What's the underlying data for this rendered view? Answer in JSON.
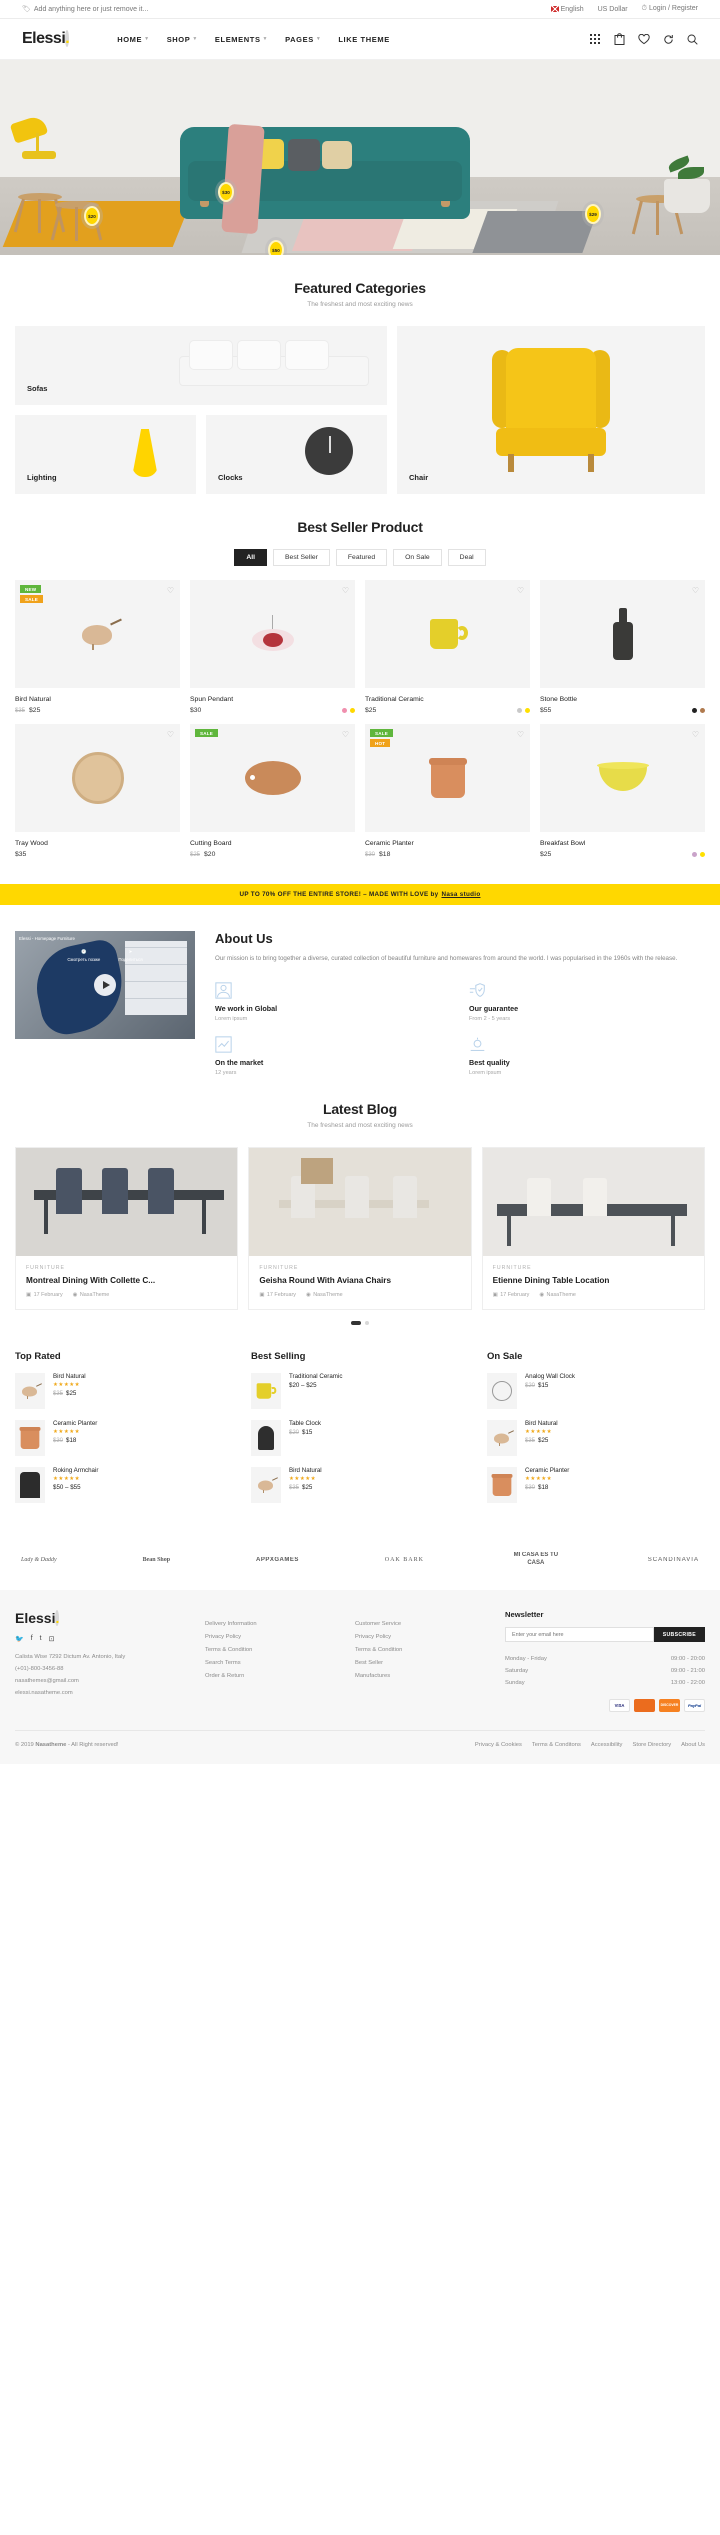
{
  "topbar": {
    "notice": "Add anything here or just remove it...",
    "language": "English",
    "currency": "US Dollar",
    "account": "Login / Register"
  },
  "header": {
    "logo": "Elessi",
    "logo_dot": ".",
    "nav": [
      "HOME",
      "SHOP",
      "ELEMENTS",
      "PAGES",
      "LIKE THEME"
    ],
    "icons": [
      "grid-icon",
      "bag-icon",
      "heart-icon",
      "refresh-icon",
      "search-icon"
    ]
  },
  "hero": {
    "price_tags": [
      "$20",
      "$30",
      "$50",
      "$29"
    ]
  },
  "featured_categories": {
    "title": "Featured Categories",
    "subtitle": "The freshest and most exciting news",
    "items": [
      {
        "label": "Sofas"
      },
      {
        "label": "Lighting"
      },
      {
        "label": "Clocks"
      },
      {
        "label": "Chair"
      }
    ]
  },
  "best_seller": {
    "title": "Best Seller Product",
    "tabs": [
      "All",
      "Best Seller",
      "Featured",
      "On Sale",
      "Deal"
    ],
    "active_tab": "All",
    "products": [
      {
        "name": "Bird Natural",
        "price": "$25",
        "old_price": "$35",
        "badges": [
          "NEW",
          "SALE"
        ],
        "swatches": []
      },
      {
        "name": "Spun Pendant",
        "price": "$30",
        "old_price": "",
        "badges": [],
        "swatches": [
          "#f08fae",
          "#ffd800"
        ]
      },
      {
        "name": "Traditional Ceramic",
        "price": "$25",
        "old_price": "",
        "badges": [],
        "swatches": [
          "#c9c9c9",
          "#ffe000"
        ]
      },
      {
        "name": "Stone Bottle",
        "price": "$55",
        "old_price": "",
        "badges": [],
        "swatches": [
          "#222222",
          "#b07a4e"
        ]
      },
      {
        "name": "Tray Wood",
        "price": "$35",
        "old_price": "",
        "badges": [],
        "swatches": []
      },
      {
        "name": "Cutting Board",
        "price": "$20",
        "old_price": "$25",
        "badges": [
          "SALE"
        ],
        "swatches": []
      },
      {
        "name": "Ceramic Planter",
        "price": "$18",
        "old_price": "$30",
        "badges": [
          "SALE",
          "HOT"
        ],
        "swatches": []
      },
      {
        "name": "Breakfast Bowl",
        "price": "$25",
        "old_price": "",
        "badges": [],
        "swatches": [
          "#c9a3c9",
          "#ffe000"
        ]
      }
    ]
  },
  "promo": {
    "text": "UP TO 70% OFF THE ENTIRE STORE! – MADE WITH LOVE by",
    "link": "Nasa studio"
  },
  "about": {
    "video": {
      "title": "Elessi - Homepage Furniture",
      "overlay_later": "Смотреть позже",
      "overlay_share": "Поделиться"
    },
    "title": "About Us",
    "paragraph": "Our mission is to bring together a diverse, curated collection of beautiful furniture and homewares from around the world. I was popularised in the 1960s with the release.",
    "features": [
      {
        "icon": "globe-person-icon",
        "title": "We work in Global",
        "sub": "Lorem ipsum"
      },
      {
        "icon": "shield-check-icon",
        "title": "Our guarantee",
        "sub": "From 2 - 5 years"
      },
      {
        "icon": "market-chart-icon",
        "title": "On the market",
        "sub": "12 years"
      },
      {
        "icon": "quality-badge-icon",
        "title": "Best quality",
        "sub": "Lorem ipsum"
      }
    ]
  },
  "blog": {
    "title": "Latest Blog",
    "subtitle": "The freshest and most exciting news",
    "posts": [
      {
        "category": "FURNITURE",
        "title": "Montreal Dining With Collette C...",
        "date": "17 February",
        "author": "NasaTheme"
      },
      {
        "category": "FURNITURE",
        "title": "Geisha Round With Aviana Chairs",
        "date": "17 February",
        "author": "NasaTheme"
      },
      {
        "category": "FURNITURE",
        "title": "Etienne Dining Table Location",
        "date": "17 February",
        "author": "NasaTheme"
      }
    ]
  },
  "lists": [
    {
      "title": "Top Rated",
      "items": [
        {
          "name": "Bird Natural",
          "stars": "★★★★★",
          "price": "$25",
          "old_price": "$35",
          "art": "bird"
        },
        {
          "name": "Ceramic Planter",
          "stars": "★★★★★",
          "price": "$18",
          "old_price": "$30",
          "art": "planter"
        },
        {
          "name": "Roking Armchair",
          "stars": "★★★★★",
          "price": "$50 – $55",
          "old_price": "",
          "art": "armchair"
        }
      ]
    },
    {
      "title": "Best Selling",
      "items": [
        {
          "name": "Traditional Ceramic",
          "stars": "",
          "price": "$20 – $25",
          "old_price": "",
          "art": "mug"
        },
        {
          "name": "Table Clock",
          "stars": "",
          "price": "$15",
          "old_price": "$20",
          "art": "clock"
        },
        {
          "name": "Bird Natural",
          "stars": "★★★★★",
          "price": "$25",
          "old_price": "$35",
          "art": "bird"
        }
      ]
    },
    {
      "title": "On Sale",
      "items": [
        {
          "name": "Analog Wall Clock",
          "stars": "",
          "price": "$15",
          "old_price": "$20",
          "art": "wallclock"
        },
        {
          "name": "Bird Natural",
          "stars": "★★★★★",
          "price": "$25",
          "old_price": "$35",
          "art": "bird"
        },
        {
          "name": "Ceramic Planter",
          "stars": "★★★★★",
          "price": "$18",
          "old_price": "$30",
          "art": "planter"
        }
      ]
    }
  ],
  "brands": [
    "Lady & Daddy",
    "Bean Shop",
    "APPXGAMES",
    "OAK BARK",
    "MI CASA ES TU CASA",
    "SCANDINAVIA"
  ],
  "footer": {
    "logo": "Elessi",
    "logo_dot": ".",
    "social": [
      "twitter-icon",
      "facebook-icon",
      "tumblr-icon",
      "instagram-icon"
    ],
    "address": "Calista Wise 7292 Dictum Av. Antonio, Italy",
    "phone": "(+01)-800-3456-88",
    "email": "nasathemes@gmail.com",
    "site": "elessi.nasatheme.com",
    "col2_title": "",
    "col2": [
      "Delivery Information",
      "Privacy Policy",
      "Terms & Condition",
      "Search Terms",
      "Order & Return"
    ],
    "col3_title": "",
    "col3": [
      "Customer Service",
      "Privacy Policy",
      "Terms & Condition",
      "Best Seller",
      "Manufactures"
    ],
    "newsletter": {
      "title": "Newsletter",
      "placeholder": "Enter your email here",
      "button": "SUBSCRIBE"
    },
    "hours": [
      {
        "day": "Monday - Friday",
        "time": "09:00 - 20:00"
      },
      {
        "day": "Saturday",
        "time": "09:00 - 21:00"
      },
      {
        "day": "Sunday",
        "time": "13:00 - 22:00"
      }
    ],
    "payments": [
      "VISA",
      "MC",
      "DISCOVER",
      "PayPal"
    ],
    "copyright_pre": "© 2019 ",
    "copyright_brand": "Nasatheme",
    "copyright_post": " - All Right reserved!",
    "bottom_links": [
      "Privacy & Cookies",
      "Terms & Conditons",
      "Accessibility",
      "Store Directory",
      "About Us"
    ]
  }
}
